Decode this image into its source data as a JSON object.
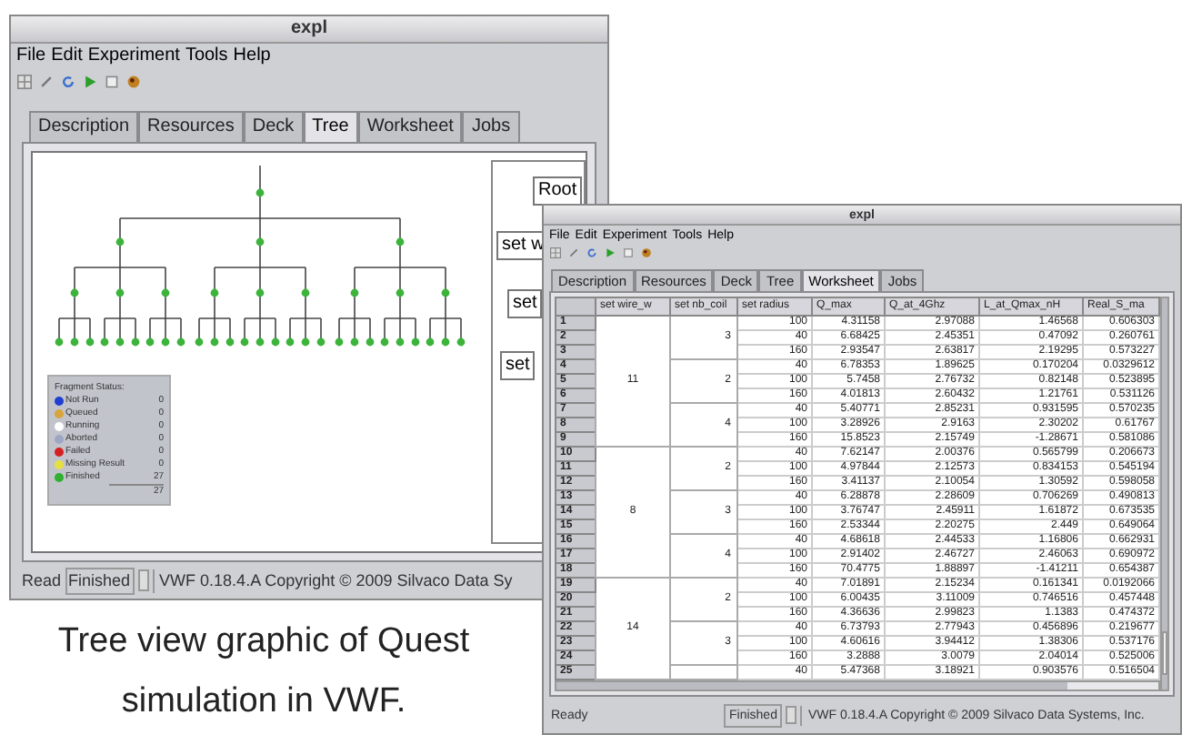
{
  "back_window": {
    "title": "expl",
    "menu": [
      "File",
      "Edit",
      "Experiment",
      "Tools",
      "Help"
    ],
    "tabs": [
      {
        "label": "Description",
        "selected": false
      },
      {
        "label": "Resources",
        "selected": false
      },
      {
        "label": "Deck",
        "selected": false
      },
      {
        "label": "Tree",
        "selected": true
      },
      {
        "label": "Worksheet",
        "selected": false
      },
      {
        "label": "Jobs",
        "selected": false
      }
    ],
    "tree_panel": {
      "nodes": [
        "Root",
        "set w",
        "set",
        "set"
      ]
    },
    "fragment_status": {
      "title": "Fragment Status:",
      "total": "27",
      "items": [
        {
          "label": "Not Run",
          "count": "0",
          "color": "#1f3fd0"
        },
        {
          "label": "Queued",
          "count": "0",
          "color": "#d9a43a"
        },
        {
          "label": "Running",
          "count": "0",
          "color": "#ffffff"
        },
        {
          "label": "Aborted",
          "count": "0",
          "color": "#9ea6c4"
        },
        {
          "label": "Failed",
          "count": "0",
          "color": "#d42020"
        },
        {
          "label": "Missing Result",
          "count": "0",
          "color": "#e8e040"
        },
        {
          "label": "Finished",
          "count": "27",
          "color": "#30b030"
        }
      ]
    },
    "status_bar": [
      "Read",
      "Finished",
      "VWF 0.18.4.A Copyright © 2009 Silvaco Data Sy"
    ]
  },
  "front_window": {
    "title": "expl",
    "menu": [
      "File",
      "Edit",
      "Experiment",
      "Tools",
      "Help"
    ],
    "tabs": [
      {
        "label": "Description",
        "selected": false
      },
      {
        "label": "Resources",
        "selected": false
      },
      {
        "label": "Deck",
        "selected": false
      },
      {
        "label": "Tree",
        "selected": false
      },
      {
        "label": "Worksheet",
        "selected": true
      },
      {
        "label": "Jobs",
        "selected": false
      }
    ],
    "table": {
      "columns": [
        "set wire_w",
        "set nb_coil",
        "set radius",
        "Q_max",
        "Q_at_4Ghz",
        "L_at_Qmax_nH",
        "Real_S_ma"
      ],
      "groups": [
        {
          "value": "11",
          "children": [
            {
              "value": "3",
              "rows": [
                {
                  "number": "1",
                  "cells": [
                    "100",
                    "4.31158",
                    "2.97088",
                    "1.46568",
                    "0.606303"
                  ]
                },
                {
                  "number": "2",
                  "cells": [
                    "40",
                    "6.68425",
                    "2.45351",
                    "0.47092",
                    "0.260761"
                  ]
                },
                {
                  "number": "3",
                  "cells": [
                    "160",
                    "2.93547",
                    "2.63817",
                    "2.19295",
                    "0.573227"
                  ]
                }
              ]
            },
            {
              "value": "2",
              "rows": [
                {
                  "number": "4",
                  "cells": [
                    "40",
                    "6.78353",
                    "1.89625",
                    "0.170204",
                    "0.0329612"
                  ]
                },
                {
                  "number": "5",
                  "cells": [
                    "100",
                    "5.7458",
                    "2.76732",
                    "0.82148",
                    "0.523895"
                  ]
                },
                {
                  "number": "6",
                  "cells": [
                    "160",
                    "4.01813",
                    "2.60432",
                    "1.21761",
                    "0.531126"
                  ]
                }
              ]
            },
            {
              "value": "4",
              "rows": [
                {
                  "number": "7",
                  "cells": [
                    "40",
                    "5.40771",
                    "2.85231",
                    "0.931595",
                    "0.570235"
                  ]
                },
                {
                  "number": "8",
                  "cells": [
                    "100",
                    "3.28926",
                    "2.9163",
                    "2.30202",
                    "0.61767"
                  ]
                },
                {
                  "number": "9",
                  "cells": [
                    "160",
                    "15.8523",
                    "2.15749",
                    "-1.28671",
                    "0.581086"
                  ]
                }
              ]
            }
          ]
        },
        {
          "value": "8",
          "children": [
            {
              "value": "2",
              "rows": [
                {
                  "number": "10",
                  "cells": [
                    "40",
                    "7.62147",
                    "2.00376",
                    "0.565799",
                    "0.206673"
                  ]
                },
                {
                  "number": "11",
                  "cells": [
                    "100",
                    "4.97844",
                    "2.12573",
                    "0.834153",
                    "0.545194"
                  ]
                },
                {
                  "number": "12",
                  "cells": [
                    "160",
                    "3.41137",
                    "2.10054",
                    "1.30592",
                    "0.598058"
                  ]
                }
              ]
            },
            {
              "value": "3",
              "rows": [
                {
                  "number": "13",
                  "cells": [
                    "40",
                    "6.28878",
                    "2.28609",
                    "0.706269",
                    "0.490813"
                  ]
                },
                {
                  "number": "14",
                  "cells": [
                    "100",
                    "3.76747",
                    "2.45911",
                    "1.61872",
                    "0.673535"
                  ]
                },
                {
                  "number": "15",
                  "cells": [
                    "160",
                    "2.53344",
                    "2.20275",
                    "2.449",
                    "0.649064"
                  ]
                }
              ]
            },
            {
              "value": "4",
              "rows": [
                {
                  "number": "16",
                  "cells": [
                    "40",
                    "4.68618",
                    "2.44533",
                    "1.16806",
                    "0.662931"
                  ]
                },
                {
                  "number": "17",
                  "cells": [
                    "100",
                    "2.91402",
                    "2.46727",
                    "2.46063",
                    "0.690972"
                  ]
                },
                {
                  "number": "18",
                  "cells": [
                    "160",
                    "70.4775",
                    "1.88897",
                    "-1.41211",
                    "0.654387"
                  ]
                }
              ]
            }
          ]
        },
        {
          "value": "14",
          "children": [
            {
              "value": "2",
              "rows": [
                {
                  "number": "19",
                  "cells": [
                    "40",
                    "7.01891",
                    "2.15234",
                    "0.161341",
                    "0.0192066"
                  ]
                },
                {
                  "number": "20",
                  "cells": [
                    "100",
                    "6.00435",
                    "3.11009",
                    "0.746516",
                    "0.457448"
                  ]
                },
                {
                  "number": "21",
                  "cells": [
                    "160",
                    "4.36636",
                    "2.99823",
                    "1.1383",
                    "0.474372"
                  ]
                }
              ]
            },
            {
              "value": "3",
              "rows": [
                {
                  "number": "22",
                  "cells": [
                    "40",
                    "6.73793",
                    "2.77943",
                    "0.456896",
                    "0.219677"
                  ]
                },
                {
                  "number": "23",
                  "cells": [
                    "100",
                    "4.60616",
                    "3.94412",
                    "1.38306",
                    "0.537176"
                  ]
                },
                {
                  "number": "24",
                  "cells": [
                    "160",
                    "3.2888",
                    "3.0079",
                    "2.04014",
                    "0.525006"
                  ]
                }
              ]
            },
            {
              "rows": [
                {
                  "number": "25",
                  "cells": [
                    "40",
                    "5.47368",
                    "3.18921",
                    "0.903576",
                    "0.516504"
                  ]
                }
              ]
            }
          ]
        }
      ]
    },
    "status_bar": [
      "Ready",
      "Finished",
      "VWF 0.18.4.A Copyright © 2009 Silvaco Data Systems, Inc."
    ]
  },
  "caption": "Tree view graphic of Quest simulation in VWF."
}
